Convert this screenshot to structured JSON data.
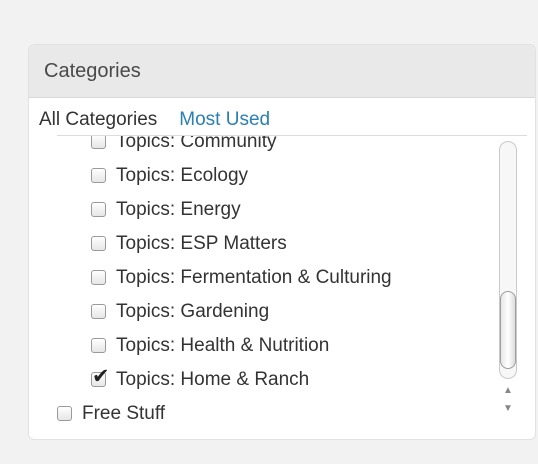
{
  "panel": {
    "title": "Categories",
    "tabs": [
      {
        "label": "All Categories"
      },
      {
        "label": "Most Used"
      }
    ],
    "items": [
      {
        "label": "Topics: Community",
        "checked": false
      },
      {
        "label": "Topics: Ecology",
        "checked": false
      },
      {
        "label": "Topics: Energy",
        "checked": false
      },
      {
        "label": "Topics: ESP Matters",
        "checked": false
      },
      {
        "label": "Topics: Fermentation & Culturing",
        "checked": false
      },
      {
        "label": "Topics: Gardening",
        "checked": false
      },
      {
        "label": "Topics: Health & Nutrition",
        "checked": false
      },
      {
        "label": "Topics: Home & Ranch",
        "checked": true
      },
      {
        "label": "Free Stuff",
        "checked": false
      }
    ]
  },
  "scrollbar": {
    "up_arrow": "▲",
    "down_arrow": "▼"
  }
}
